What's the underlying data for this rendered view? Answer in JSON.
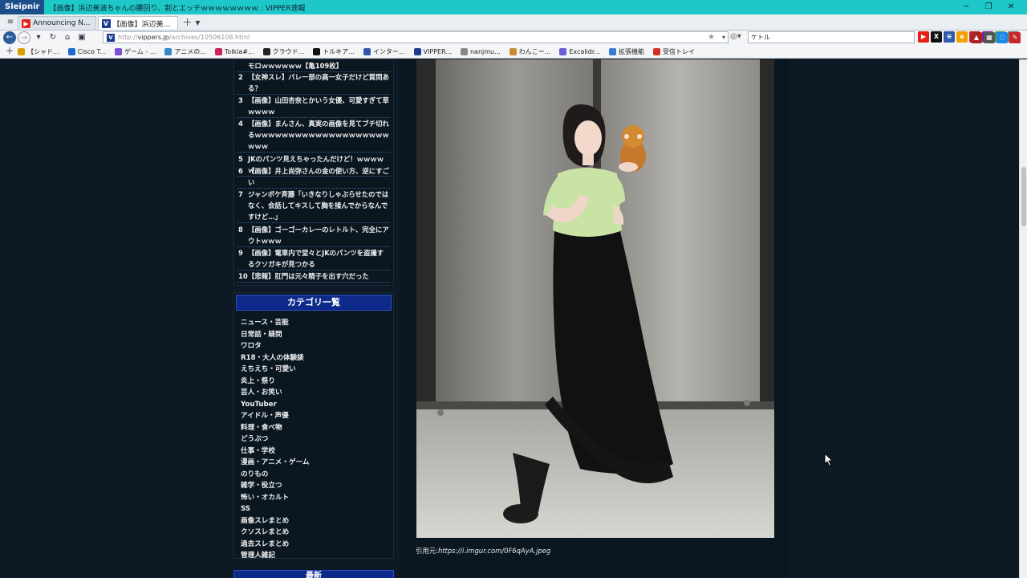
{
  "window": {
    "app_name": "Sleipnir",
    "title": "【画像】浜辺美波ちゃんの腰回り、割とエッチｗｗｗｗｗｗｗｗ : VIPPER速報",
    "controls": [
      "─",
      "❐",
      "✕"
    ]
  },
  "tabs": [
    {
      "label": "Announcing N...",
      "favicon": "youtube-icon",
      "active": false
    },
    {
      "label": "【画像】浜辺美波...",
      "favicon": "vipper-icon",
      "active": true
    }
  ],
  "address": {
    "url_prefix": "http://",
    "url_domain": "vippers.jp",
    "url_path": "/archives/10506108.html",
    "search_value": "ケトル"
  },
  "bookmarks": [
    {
      "label": "【シャド...",
      "icon": "bookmark-icon",
      "color": "#d9a000"
    },
    {
      "label": "Cisco T...",
      "icon": "cisco-icon",
      "color": "#1b6ad1"
    },
    {
      "label": "ゲーム - ...",
      "icon": "game-icon",
      "color": "#7a4fd1"
    },
    {
      "label": "アニメの...",
      "icon": "anime-icon",
      "color": "#3388cc"
    },
    {
      "label": "Tolkia#...",
      "icon": "tolkia-icon",
      "color": "#cc2255"
    },
    {
      "label": "クラウド...",
      "icon": "cloud-icon",
      "color": "#222222"
    },
    {
      "label": "トルキア...",
      "icon": "x-icon",
      "color": "#111111"
    },
    {
      "label": "インター...",
      "icon": "inter-icon",
      "color": "#3355aa"
    },
    {
      "label": "VIPPER...",
      "icon": "vipper-icon",
      "color": "#1b3d8f"
    },
    {
      "label": "nanjmu...",
      "icon": "nanj-icon",
      "color": "#888888"
    },
    {
      "label": "わんこー...",
      "icon": "dog-icon",
      "color": "#cc8833"
    },
    {
      "label": "Excalidr...",
      "icon": "excalidraw-icon",
      "color": "#6b5bd6"
    },
    {
      "label": "拡張機能",
      "icon": "extension-icon",
      "color": "#3a7bd5"
    },
    {
      "label": "受信トレイ",
      "icon": "gmail-icon",
      "color": "#d93025"
    }
  ],
  "ranking": [
    {
      "num": "",
      "text": "モロｗｗｗｗｗｗ【亀109枚】"
    },
    {
      "num": "2",
      "text": "【女神スレ】バレー部の高一女子だけど質問ある？"
    },
    {
      "num": "3",
      "text": "【画像】山田杏奈とかいう女優、可愛すぎて草ｗｗｗｗ"
    },
    {
      "num": "4",
      "text": "【画像】まんさん、真実の画像を見てブチ切れるｗｗｗｗｗｗｗｗｗｗｗｗｗｗｗｗｗｗｗｗｗｗｗ"
    },
    {
      "num": "5",
      "text": "JKのパンツ見えちゃったんだけど！ｗｗｗｗｗ"
    },
    {
      "num": "6",
      "text": "【画像】井上尚弥さんの金の使い方、逆にすごい"
    },
    {
      "num": "7",
      "text": "ジャンボケ斉藤「いきなりしゃぶらせたのではなく、会話してキスして胸を揉んでからなんですけど…」"
    },
    {
      "num": "8",
      "text": "【画像】ゴーゴーカレーのレトルト、完全にアウトｗｗｗ"
    },
    {
      "num": "9",
      "text": "【画像】電車内で堂々とJKのパンツを盗撮するクソガキが見つかる"
    },
    {
      "num": "10",
      "text": "【悲報】肛門は元々精子を出す穴だった"
    }
  ],
  "categories": {
    "title": "カテゴリ一覧",
    "items": [
      "ニュース・芸能",
      "日常話・疑問",
      "ワロタ",
      "R18・大人の体験談",
      "えちえち・可愛い",
      "炎上・祭り",
      "芸人・お笑い",
      "YouTuber",
      "アイドル・声優",
      "料理・食べ物",
      "どうぶつ",
      "仕事・学校",
      "漫画・アニメ・ゲーム",
      "のりもの",
      "雑学・役立つ",
      "怖い・オカルト",
      "SS",
      "画像スレまとめ",
      "クソスレまとめ",
      "過去スレまとめ",
      "管理人雑記"
    ]
  },
  "next_section_label": "最新",
  "caption": {
    "prefix": "引用元:",
    "url": "https://i.imgur.com/0F6qAyA.jpeg"
  },
  "colors": {
    "titlebar": "#1ec8c8",
    "page_bg": "#0d1a26",
    "panel_bg": "#0a1620",
    "category_header": "#0d2a8a"
  }
}
